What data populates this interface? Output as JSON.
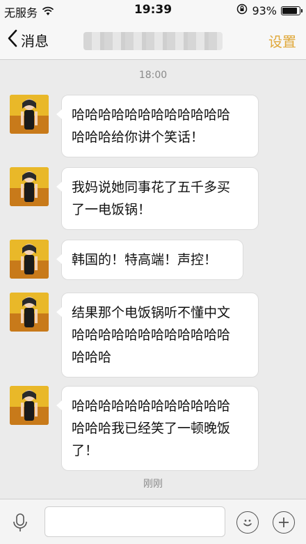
{
  "status_bar": {
    "carrier": "无服务",
    "time": "19:39",
    "battery_percent": "93%",
    "battery_level": 0.93
  },
  "nav": {
    "back_label": "消息",
    "contact_name": "",
    "settings_label": "设置"
  },
  "chat": {
    "timestamp_top": "18:00",
    "timestamp_bottom": "刚刚",
    "messages": [
      {
        "line1": "哈哈哈哈哈哈哈哈哈哈哈哈",
        "line2": "哈哈哈给你讲个笑话！",
        "line3": ""
      },
      {
        "line1": "我妈说她同事花了五千多买",
        "line2": "了一电饭锅！",
        "line3": ""
      },
      {
        "line1": "韩国的！特高端！声控！",
        "line2": "",
        "line3": ""
      },
      {
        "line1": "结果那个电饭锅听不懂中文",
        "line2": "哈哈哈哈哈哈哈哈哈哈哈哈",
        "line3": "哈哈哈"
      },
      {
        "line1": "哈哈哈哈哈哈哈哈哈哈哈哈",
        "line2": "哈哈哈我已经笑了一顿晚饭",
        "line3": "了！"
      }
    ]
  },
  "input": {
    "placeholder": ""
  },
  "icons": {
    "back": "chevron-left-icon",
    "wifi": "wifi-icon",
    "lock_rotation": "rotation-lock-icon",
    "battery": "battery-icon",
    "mic": "microphone-icon",
    "emoji": "smiley-icon",
    "add": "plus-icon"
  },
  "colors": {
    "accent": "#e0a83a",
    "background": "#ebebeb",
    "bubble": "#ffffff"
  }
}
